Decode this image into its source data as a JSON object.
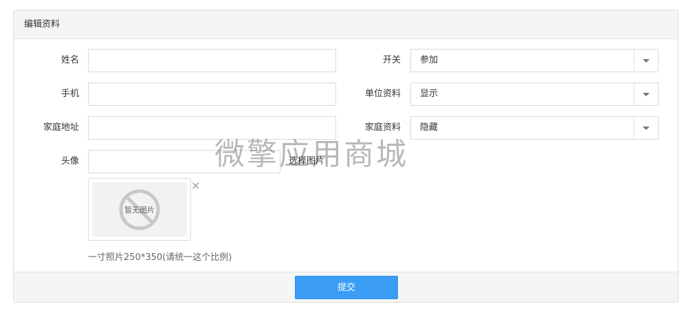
{
  "panel": {
    "title": "编辑资料"
  },
  "form": {
    "name_label": "姓名",
    "phone_label": "手机",
    "address_label": "家庭地址",
    "avatar_label": "头像",
    "name_value": "",
    "phone_value": "",
    "address_value": "",
    "avatar_value": "",
    "pick_image_label": "选择图片",
    "no_image_text": "暂无图片",
    "close_glyph": "×",
    "hint": "一寸照片250*350(请统一这个比例)",
    "switch_label": "开关",
    "switch_value": "参加",
    "unit_label": "单位资料",
    "unit_value": "显示",
    "home_label": "家庭资料",
    "home_value": "隐藏"
  },
  "watermark": "微擎应用商城",
  "footer": {
    "submit_label": "提交"
  },
  "colors": {
    "primary": "#3b9cf6",
    "header_bg": "#f5f5f5",
    "border": "#d9d9d9"
  }
}
